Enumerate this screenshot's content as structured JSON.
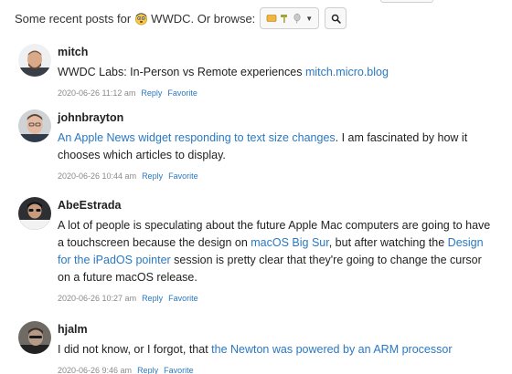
{
  "header": {
    "prefix": "Some recent posts for",
    "tag": "WWDC. Or browse:",
    "emoji_browse": [
      "card-emoji",
      "hammer-emoji",
      "balloon-emoji"
    ],
    "search_icon": "magnifier-icon"
  },
  "posts": [
    {
      "username": "mitch",
      "text": [
        "WWDC Labs: In-Person vs Remote experiences "
      ],
      "links": [
        "mitch.micro.blog"
      ],
      "date": "2020-06-26 11:12 am",
      "reply": "Reply",
      "favorite": "Favorite"
    },
    {
      "username": "johnbrayton",
      "links": [
        "An Apple News widget responding to text size changes"
      ],
      "text": [
        ". I am fascinated by how it chooses which articles to display."
      ],
      "date": "2020-06-26 10:44 am",
      "reply": "Reply",
      "favorite": "Favorite"
    },
    {
      "username": "AbeEstrada",
      "text": [
        "A lot of people is speculating about the future Apple Mac computers are going to have a touchscreen because the design on ",
        ", but after watching the ",
        " session is pretty clear that they're going to change the cursor on a future macOS release."
      ],
      "links": [
        "macOS Big Sur",
        "Design for the iPadOS pointer"
      ],
      "date": "2020-06-26 10:27 am",
      "reply": "Reply",
      "favorite": "Favorite"
    },
    {
      "username": "hjalm",
      "text": [
        "I did not know, or I forgot, that "
      ],
      "links": [
        "the Newton was powered by an ARM processor"
      ],
      "date": "2020-06-26 9:46 am",
      "reply": "Reply",
      "favorite": "Favorite"
    }
  ],
  "colors": {
    "link": "#2a78c2",
    "meta": "#8a8a8a"
  }
}
